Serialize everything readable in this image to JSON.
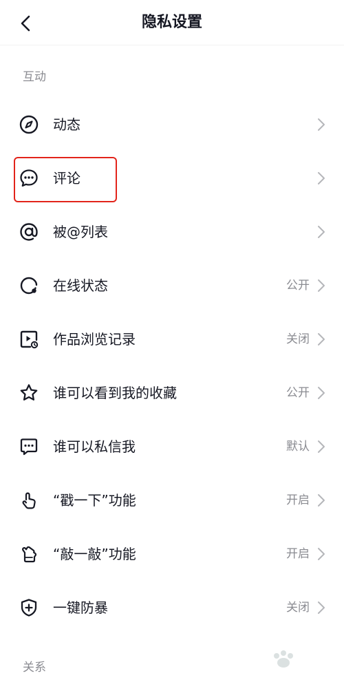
{
  "header": {
    "title": "隐私设置"
  },
  "sections": {
    "interaction": "互动",
    "relations": "关系"
  },
  "items": [
    {
      "label": "动态",
      "value": "",
      "icon": "compass-icon"
    },
    {
      "label": "评论",
      "value": "",
      "icon": "comment-icon"
    },
    {
      "label": "被@列表",
      "value": "",
      "icon": "at-icon"
    },
    {
      "label": "在线状态",
      "value": "公开",
      "icon": "online-status-icon"
    },
    {
      "label": "作品浏览记录",
      "value": "关闭",
      "icon": "video-history-icon"
    },
    {
      "label": "谁可以看到我的收藏",
      "value": "公开",
      "icon": "star-icon"
    },
    {
      "label": "谁可以私信我",
      "value": "默认",
      "icon": "message-icon"
    },
    {
      "label": "“戳一下”功能",
      "value": "开启",
      "icon": "finger-tap-icon"
    },
    {
      "label": "“敲一敲”功能",
      "value": "开启",
      "icon": "knock-hand-icon"
    },
    {
      "label": "一键防暴",
      "value": "关闭",
      "icon": "shield-plus-icon"
    }
  ],
  "colors": {
    "text": "#161823",
    "secondary": "#8a8b91",
    "highlight": "#e2231a"
  }
}
